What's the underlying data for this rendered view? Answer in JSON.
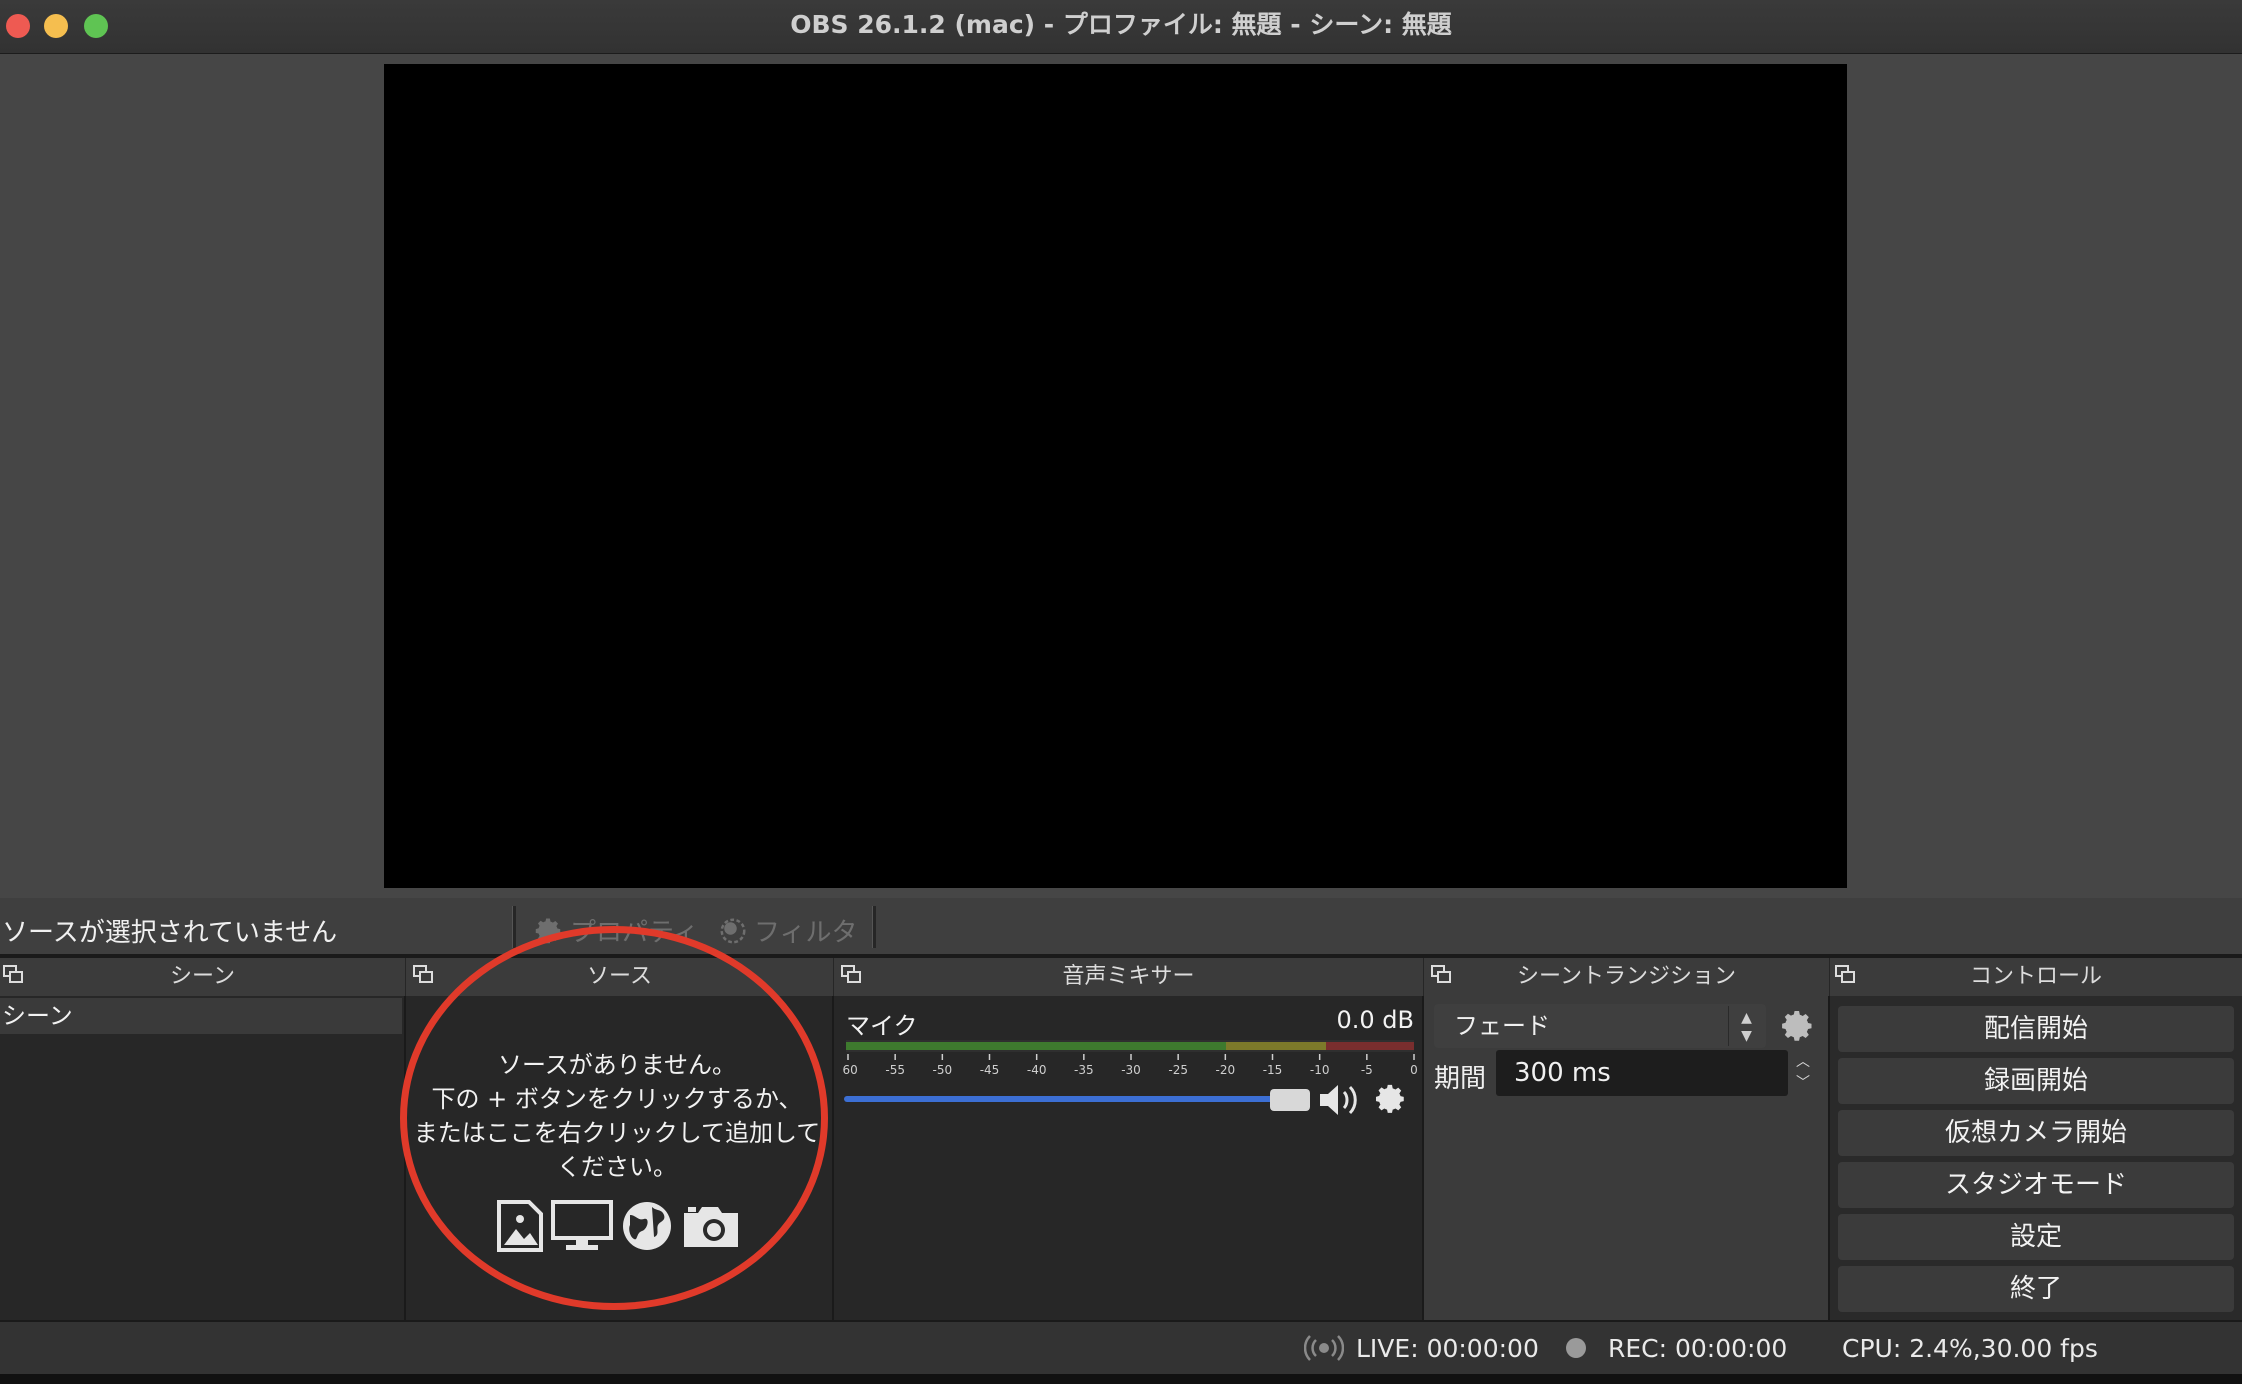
{
  "window": {
    "title": "OBS 26.1.2 (mac) - プロファイル: 無題 - シーン: 無題"
  },
  "source_toolbar": {
    "selection_text": "ソースが選択されていません",
    "properties_label": "プロパティ",
    "filters_label": "フィルタ"
  },
  "docks": {
    "scenes": {
      "title": "シーン",
      "items": [
        "シーン"
      ]
    },
    "sources": {
      "title": "ソース",
      "empty_line1": "ソースがありません。",
      "empty_line2": "下の + ボタンをクリックするか、",
      "empty_line3": "またはここを右クリックして追加して",
      "empty_line4": "ください。",
      "icons": [
        "image-icon",
        "display-icon",
        "globe-icon",
        "camera-icon"
      ]
    },
    "mixer": {
      "title": "音声ミキサー",
      "channel_name": "マイク",
      "level": "0.0 dB",
      "ticks": [
        "-60",
        "-55",
        "-50",
        "-45",
        "-40",
        "-35",
        "-30",
        "-25",
        "-20",
        "-15",
        "-10",
        "-5",
        "0"
      ],
      "volume_fraction": 0.95
    },
    "transitions": {
      "title": "シーントランジション",
      "selected": "フェード",
      "duration_label": "期間",
      "duration_value": "300 ms"
    },
    "controls": {
      "title": "コントロール",
      "start_streaming": "配信開始",
      "start_recording": "録画開始",
      "start_virtual_camera": "仮想カメラ開始",
      "studio_mode": "スタジオモード",
      "settings": "設定",
      "exit": "終了"
    }
  },
  "status": {
    "live": "LIVE: 00:00:00",
    "rec": "REC: 00:00:00",
    "cpu": "CPU: 2.4%,30.00 fps"
  },
  "colors": {
    "annotation_circle": "#e03a2a",
    "volume_slider": "#3c6fd4",
    "close": "#ee5a52",
    "minimize": "#f5be4f",
    "maximize": "#5fc453"
  }
}
